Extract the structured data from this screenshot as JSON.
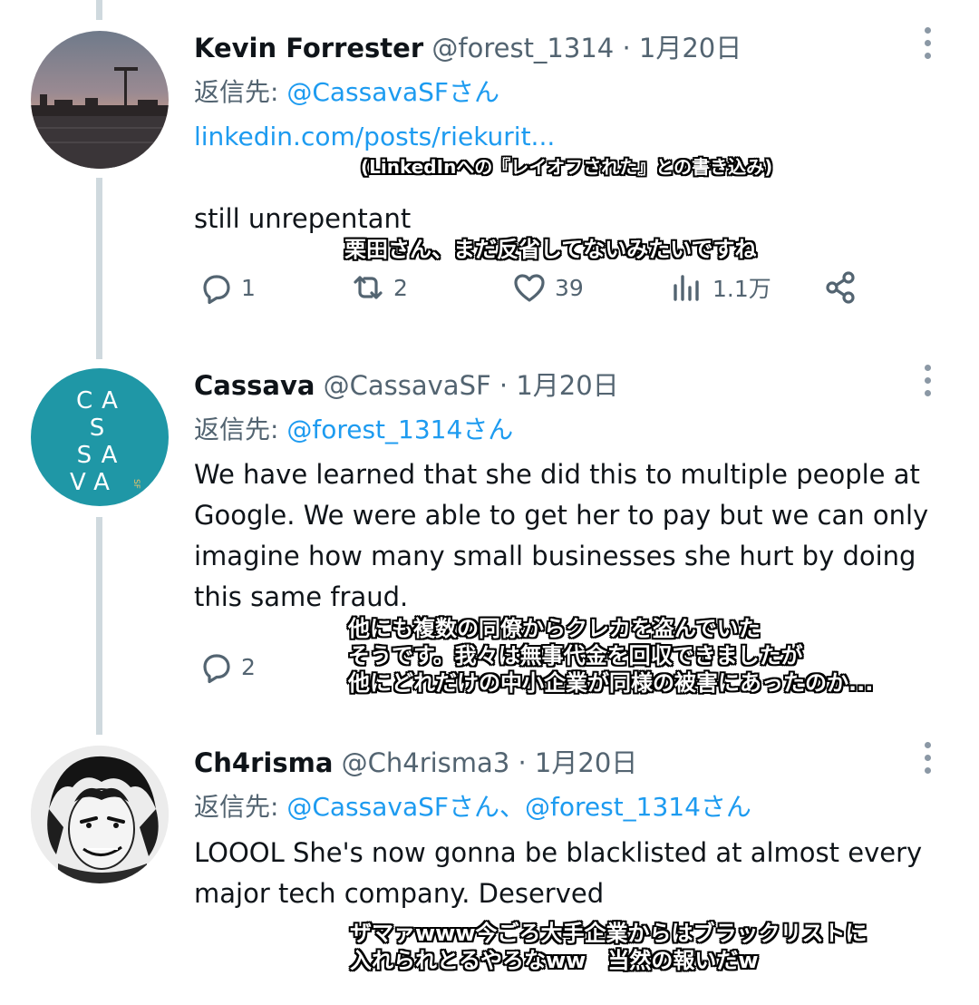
{
  "tweets": [
    {
      "name": "Kevin Forrester",
      "handle": "@forest_1314",
      "date": "· 1月20日",
      "reply_label": "返信先:",
      "reply_mentions": "@CassavaSFさん",
      "link": "linkedin.com/posts/riekurit...",
      "link_note": "(LinkedInへの『レイオフされた』との書き込み)",
      "text_lines": [
        "still unrepentant"
      ],
      "translation_lines": [
        "栗田さん、まだ反省してないみたいですね"
      ],
      "replies": "1",
      "retweets": "2",
      "likes": "39",
      "views": "1.1万"
    },
    {
      "name": "Cassava",
      "handle": "@CassavaSF",
      "date": "· 1月20日",
      "reply_label": "返信先:",
      "reply_mentions": "@forest_1314さん",
      "avatar_letters": [
        "CA",
        "S",
        "SA",
        "VA"
      ],
      "avatar_sub": "SF",
      "text_lines": [
        "We have learned that she did this to multiple people at",
        "Google. We were able to get her to pay but we can only",
        "imagine how many small businesses she hurt by doing",
        "this same fraud."
      ],
      "translation_lines": [
        "他にも複数の同僚からクレカを盗んでいた",
        "そうです。我々は無事代金を回収できましたが",
        "他にどれだけの中小企業が同様の被害にあったのか..."
      ],
      "replies": "2"
    },
    {
      "name": "Ch4risma",
      "handle": "@Ch4risma3",
      "date": "· 1月20日",
      "reply_label": "返信先:",
      "reply_mentions": "@CassavaSFさん、@forest_1314さん",
      "text_lines": [
        "LOOOL She's now gonna be blacklisted at almost every",
        "major tech company. Deserved"
      ],
      "translation_lines": [
        "ザマァwww今ごろ大手企業からはブラックリストに",
        "入れられとるやろなww　当然の報いだw"
      ]
    }
  ],
  "colors": {
    "accent": "#1d9bf0",
    "muted": "#536471",
    "thread_line": "#cfd9de",
    "cassava_teal": "#1f97a6"
  },
  "icons": [
    "reply-icon",
    "retweet-icon",
    "like-icon",
    "views-icon",
    "share-icon",
    "more-icon"
  ]
}
